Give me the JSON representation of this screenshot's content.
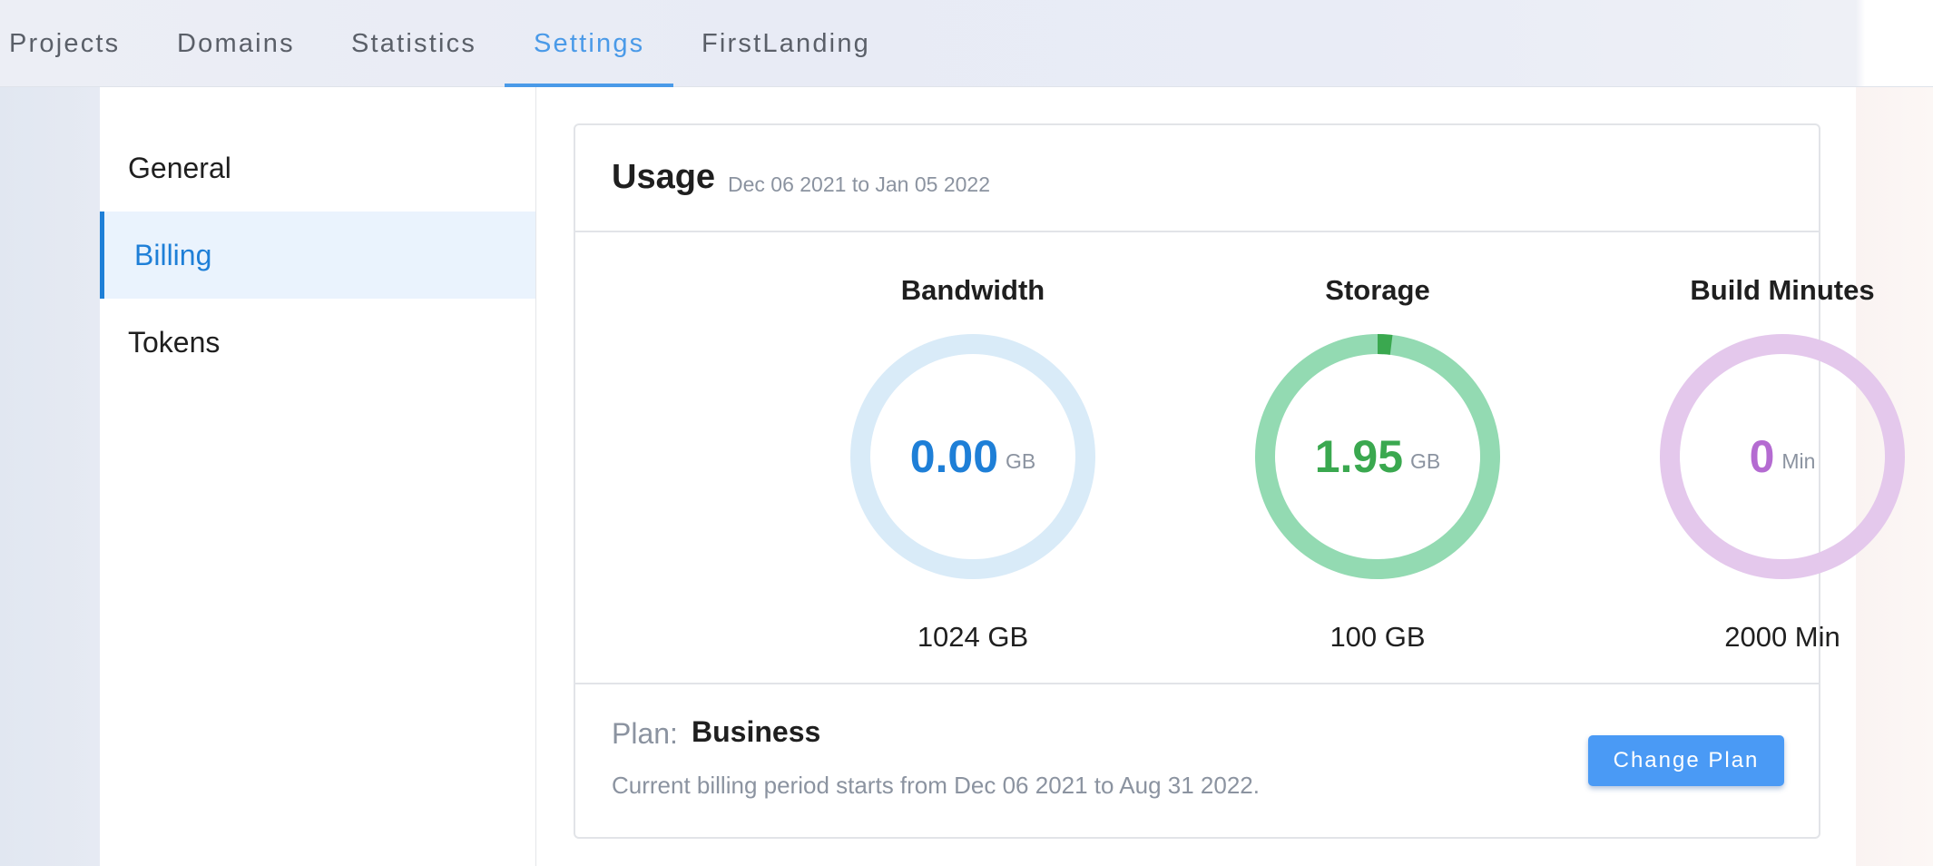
{
  "nav": {
    "tabs": [
      {
        "label": "Projects",
        "active": false
      },
      {
        "label": "Domains",
        "active": false
      },
      {
        "label": "Statistics",
        "active": false
      },
      {
        "label": "Settings",
        "active": true
      },
      {
        "label": "FirstLanding",
        "active": false
      }
    ]
  },
  "sidebar": {
    "items": [
      {
        "label": "General",
        "active": false
      },
      {
        "label": "Billing",
        "active": true
      },
      {
        "label": "Tokens",
        "active": false
      }
    ]
  },
  "usage": {
    "title": "Usage",
    "date_range": "Dec 06 2021 to Jan 05 2022",
    "metrics": [
      {
        "title": "Bandwidth",
        "value": "0.00",
        "unit": "GB",
        "limit": "1024 GB",
        "fraction": 0.0,
        "color": "#1e7fd7",
        "track_color": "#d9ebf8"
      },
      {
        "title": "Storage",
        "value": "1.95",
        "unit": "GB",
        "limit": "100 GB",
        "fraction": 0.0195,
        "color": "#3aa84f",
        "track_color": "#93dab2"
      },
      {
        "title": "Build Minutes",
        "value": "0",
        "unit": "Min",
        "limit": "2000 Min",
        "fraction": 0.0,
        "color": "#b46bd1",
        "track_color": "#e4c8ec"
      }
    ]
  },
  "plan": {
    "label": "Plan:",
    "name": "Business",
    "billing_period": "Current billing period starts from Dec 06 2021 to Aug 31 2022.",
    "change_button": "Change Plan"
  },
  "colors": {
    "accent": "#4a9ae8",
    "button": "#4a9af5",
    "sidebar_active": "#1e7fd7"
  }
}
